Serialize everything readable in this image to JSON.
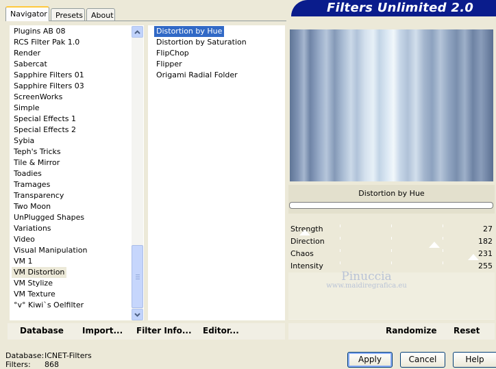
{
  "tabs": [
    "Navigator",
    "Presets",
    "About"
  ],
  "banner": "Filters Unlimited 2.0",
  "categories": [
    "Plugins AB 08",
    "RCS Filter Pak 1.0",
    "Render",
    "Sabercat",
    "Sapphire Filters 01",
    "Sapphire Filters 03",
    "ScreenWorks",
    "Simple",
    "Special Effects 1",
    "Special Effects 2",
    "Sybia",
    "Teph's Tricks",
    "Tile & Mirror",
    "Toadies",
    "Tramages",
    "Transparency",
    "Two Moon",
    "UnPlugged Shapes",
    "Variations",
    "Video",
    "Visual Manipulation",
    "VM 1",
    "VM Distortion",
    "VM Stylize",
    "VM Texture",
    "°v° Kiwi`s Oelfilter"
  ],
  "selected_category": "VM Distortion",
  "filters": [
    "Distortion by Hue",
    "Distortion by Saturation",
    "FlipChop",
    "Flipper",
    "Origami Radial Folder"
  ],
  "selected_filter": "Distortion by Hue",
  "current_filter_name": "Distortion by Hue",
  "params": [
    {
      "label": "Strength",
      "value": "27"
    },
    {
      "label": "Direction",
      "value": "182"
    },
    {
      "label": "Chaos",
      "value": "231"
    },
    {
      "label": "Intensity",
      "value": "255"
    }
  ],
  "watermark": {
    "title": "Pinuccia",
    "url": "www.maidiregrafica.eu"
  },
  "toolbar": {
    "database": "Database",
    "import": "Import...",
    "filter_info": "Filter Info...",
    "editor": "Editor...",
    "randomize": "Randomize",
    "reset": "Reset"
  },
  "buttons": {
    "apply": "Apply",
    "cancel": "Cancel",
    "help": "Help"
  },
  "status": {
    "database_label": "Database:",
    "database_value": "ICNET-Filters",
    "filters_label": "Filters:",
    "filters_value": "868"
  }
}
